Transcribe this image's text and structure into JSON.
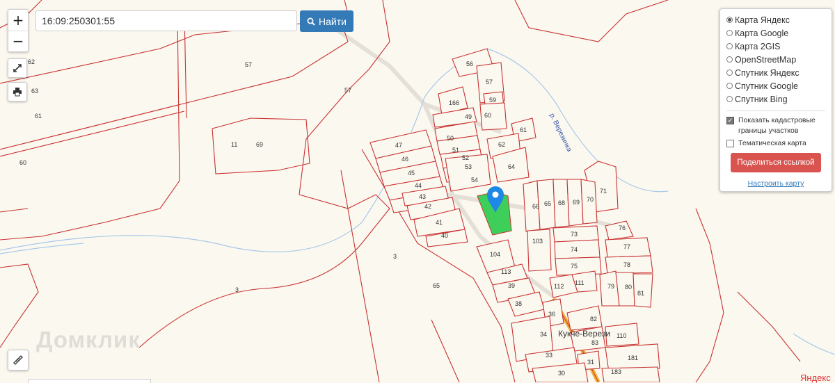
{
  "search": {
    "value": "16:09:250301:55",
    "button_label": "Найти"
  },
  "zoom": {
    "in_label": "+",
    "out_label": "−"
  },
  "layers": {
    "map_types": [
      {
        "label": "Карта Яндекс",
        "selected": true
      },
      {
        "label": "Карта Google",
        "selected": false
      },
      {
        "label": "Карта 2GIS",
        "selected": false
      },
      {
        "label": "OpenStreetMap",
        "selected": false
      },
      {
        "label": "Спутник Яндекс",
        "selected": false
      },
      {
        "label": "Спутник Google",
        "selected": false
      },
      {
        "label": "Спутник Bing",
        "selected": false
      }
    ],
    "cadastral_label": "Показать кадастровые границы участков",
    "cadastral_checked": true,
    "thematic_label": "Тематическая карта",
    "thematic_checked": false,
    "share_label": "Поделиться ссылкой",
    "settings_label": "Настроить карту"
  },
  "map": {
    "river_label": "р. Верезинка",
    "village_label": "Кукче-Верези",
    "watermark": "Домклик",
    "copyright": "Яндекс",
    "plot_numbers": [
      "62",
      "57",
      "57",
      "63",
      "61",
      "60",
      "11",
      "69",
      "3",
      "3",
      "65",
      "56",
      "57",
      "59",
      "166",
      "49",
      "60",
      "50",
      "51",
      "61",
      "62",
      "47",
      "52",
      "46",
      "53",
      "64",
      "45",
      "54",
      "44",
      "43",
      "42",
      "41",
      "40",
      "71",
      "66",
      "65",
      "68",
      "69",
      "70",
      "76",
      "73",
      "103",
      "74",
      "77",
      "104",
      "75",
      "78",
      "113",
      "39",
      "112",
      "111",
      "79",
      "80",
      "81",
      "38",
      "36",
      "82",
      "34",
      "83",
      "110",
      "33",
      "31",
      "181",
      "30",
      "183"
    ],
    "selected_color": "#3ecf5a",
    "plot_color": "#c83232",
    "marker_color": "#1e88e5"
  }
}
